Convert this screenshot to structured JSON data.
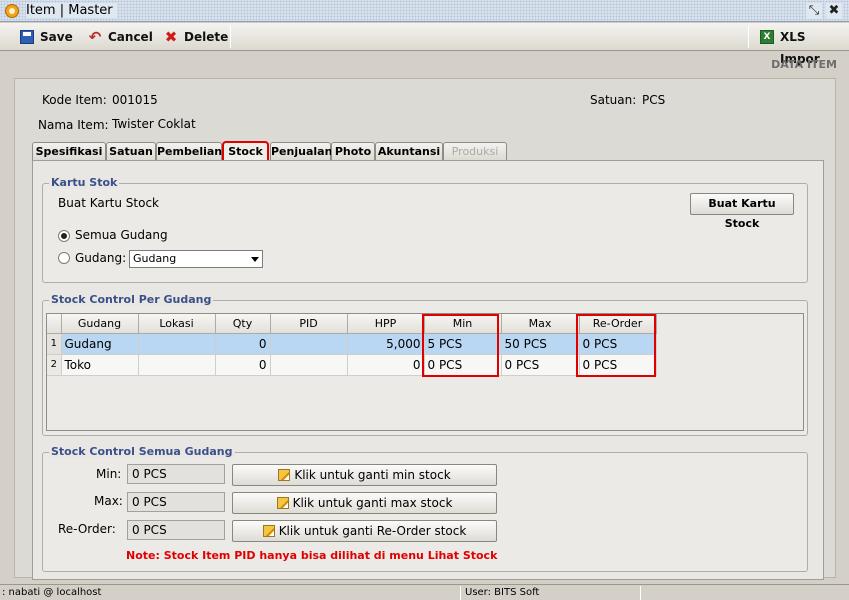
{
  "window": {
    "title": "Item | Master",
    "restore_glyph": "⤡",
    "close_glyph": "✖"
  },
  "toolbar": {
    "save_label": "Save",
    "cancel_label": "Cancel",
    "delete_label": "Delete",
    "xls_import_label": "XLS Impor"
  },
  "header": {
    "section_label": "DATA ITEM",
    "kode_item_label": "Kode Item:",
    "kode_item_value": "001015",
    "nama_item_label": "Nama Item:",
    "nama_item_value": "Twister Coklat",
    "satuan_label": "Satuan:",
    "satuan_value": "PCS"
  },
  "tabs": [
    {
      "label": "Spesifikasi"
    },
    {
      "label": "Satuan"
    },
    {
      "label": "Pembelian"
    },
    {
      "label": "Stock"
    },
    {
      "label": "Penjualan"
    },
    {
      "label": "Photo"
    },
    {
      "label": "Akuntansi"
    },
    {
      "label": "Produksi"
    }
  ],
  "kartu_stok": {
    "title": "Kartu Stok",
    "description": "Buat Kartu Stock",
    "button_label": "Buat Kartu Stock",
    "option_all": "Semua Gudang",
    "option_gudang": "Gudang:",
    "gudang_selected": "Gudang"
  },
  "stock_control_per_gudang": {
    "title": "Stock Control Per Gudang",
    "columns": [
      "Gudang",
      "Lokasi",
      "Qty",
      "PID",
      "HPP",
      "Min",
      "Max",
      "Re-Order"
    ],
    "rows": [
      {
        "no": "1",
        "gudang": "Gudang",
        "lokasi": "",
        "qty": "0",
        "pid": "",
        "hpp": "5,000",
        "min": "5 PCS",
        "max": "50 PCS",
        "reorder": "0 PCS"
      },
      {
        "no": "2",
        "gudang": "Toko",
        "lokasi": "",
        "qty": "0",
        "pid": "",
        "hpp": "0",
        "min": "0 PCS",
        "max": "0 PCS",
        "reorder": "0 PCS"
      }
    ]
  },
  "stock_control_semua_gudang": {
    "title": "Stock Control Semua Gudang",
    "min_label": "Min:",
    "min_value": "0 PCS",
    "min_button": "Klik untuk ganti min stock",
    "max_label": "Max:",
    "max_value": "0 PCS",
    "max_button": "Klik untuk ganti max stock",
    "reorder_label": "Re-Order:",
    "reorder_value": "0 PCS",
    "reorder_button": "Klik untuk ganti Re-Order stock",
    "note": "Note: Stock Item PID hanya bisa dilihat di menu Lihat Stock"
  },
  "statusbar": {
    "connection": ": nabati @ localhost",
    "user": "User: BITS Soft"
  },
  "colors": {
    "highlight": "#e00000",
    "selected_row": "#b9d6f3",
    "group_title": "#3b4f8a"
  }
}
